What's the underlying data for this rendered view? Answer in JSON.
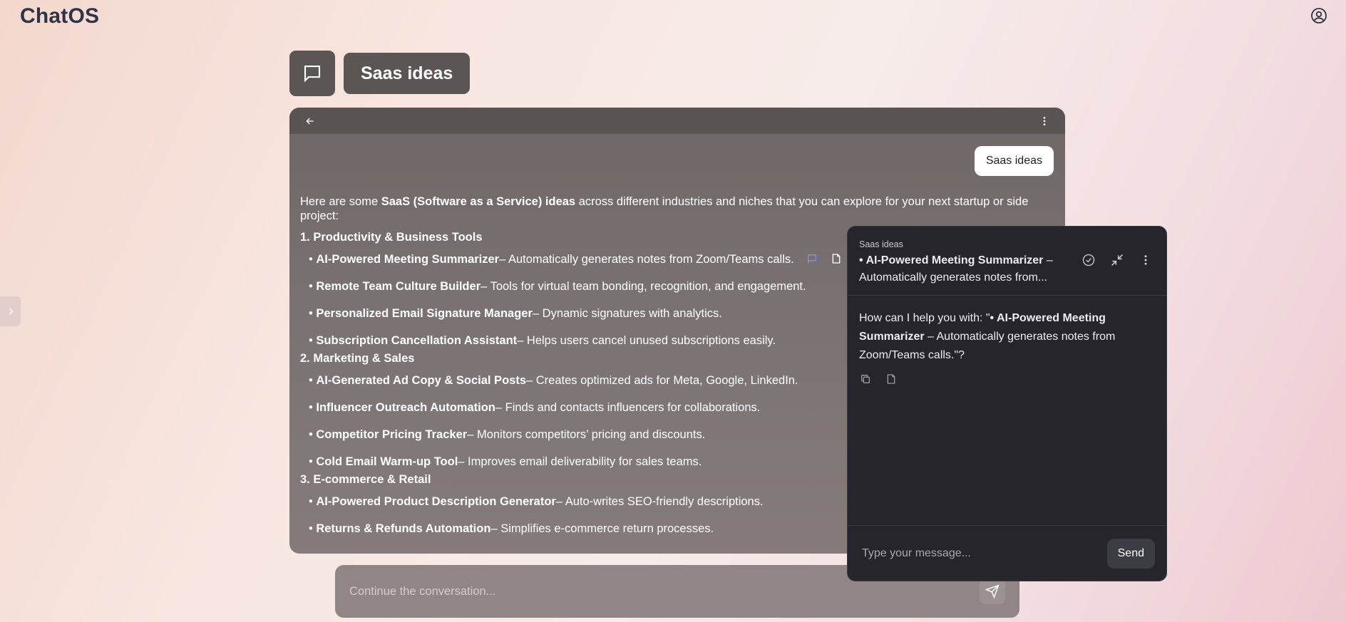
{
  "app": {
    "title": "ChatOS"
  },
  "header": {
    "chat_title": "Saas ideas"
  },
  "chat": {
    "user_message": "Saas ideas",
    "intro_before": "Here are some ",
    "intro_bold": "SaaS (Software as a Service) ideas",
    "intro_after": " across different industries and niches that you can explore for your next startup or side project:",
    "sections": [
      {
        "heading": "1. Productivity & Business Tools",
        "items": [
          {
            "title": "AI-Powered Meeting Summarizer",
            "desc": " – Automatically generates notes from Zoom/Teams calls."
          },
          {
            "title": "Remote Team Culture Builder",
            "desc": " – Tools for virtual team bonding, recognition, and engagement."
          },
          {
            "title": "Personalized Email Signature Manager",
            "desc": " – Dynamic signatures with analytics."
          },
          {
            "title": "Subscription Cancellation Assistant",
            "desc": " – Helps users cancel unused subscriptions easily."
          }
        ]
      },
      {
        "heading": "2. Marketing & Sales",
        "items": [
          {
            "title": "AI-Generated Ad Copy & Social Posts",
            "desc": " – Creates optimized ads for Meta, Google, LinkedIn."
          },
          {
            "title": "Influencer Outreach Automation",
            "desc": " – Finds and contacts influencers for collaborations."
          },
          {
            "title": "Competitor Pricing Tracker",
            "desc": " – Monitors competitors’ pricing and discounts."
          },
          {
            "title": "Cold Email Warm-up Tool",
            "desc": " – Improves email deliverability for sales teams."
          }
        ]
      },
      {
        "heading": "3. E-commerce & Retail",
        "items": [
          {
            "title": "AI-Powered Product Description Generator",
            "desc": " – Auto-writes SEO-friendly descriptions."
          },
          {
            "title": "Returns & Refunds Automation",
            "desc": " – Simplifies e-commerce return processes."
          }
        ]
      }
    ],
    "bullet_char": "•",
    "continue_placeholder": "Continue the conversation..."
  },
  "thread": {
    "crumb": "Saas ideas",
    "title_bold": "• AI-Powered Meeting Summarizer",
    "title_rest": " – Automatically generates notes from...",
    "msg_prefix": "How can I help you with: \"",
    "msg_bold": "• AI-Powered Meeting Summarizer",
    "msg_rest": " – Automatically generates notes from Zoom/Teams calls.\"?",
    "input_placeholder": "Type your message...",
    "send_label": "Send"
  },
  "icons": {
    "user": "user-circle-icon",
    "sidebar_toggle": "chevron-right-icon",
    "chat": "chat-bubble-icon",
    "back": "arrow-left-icon",
    "menu": "more-vertical-icon",
    "thread": "message-square-icon",
    "note": "note-icon",
    "resolve": "check-circle-icon",
    "minimize": "minimize-icon",
    "copy": "copy-icon",
    "send": "send-icon"
  },
  "colors": {
    "accent_icon": "#7b8cf0",
    "panel_bg": "#25252b",
    "chat_bg": "#7a7272"
  }
}
